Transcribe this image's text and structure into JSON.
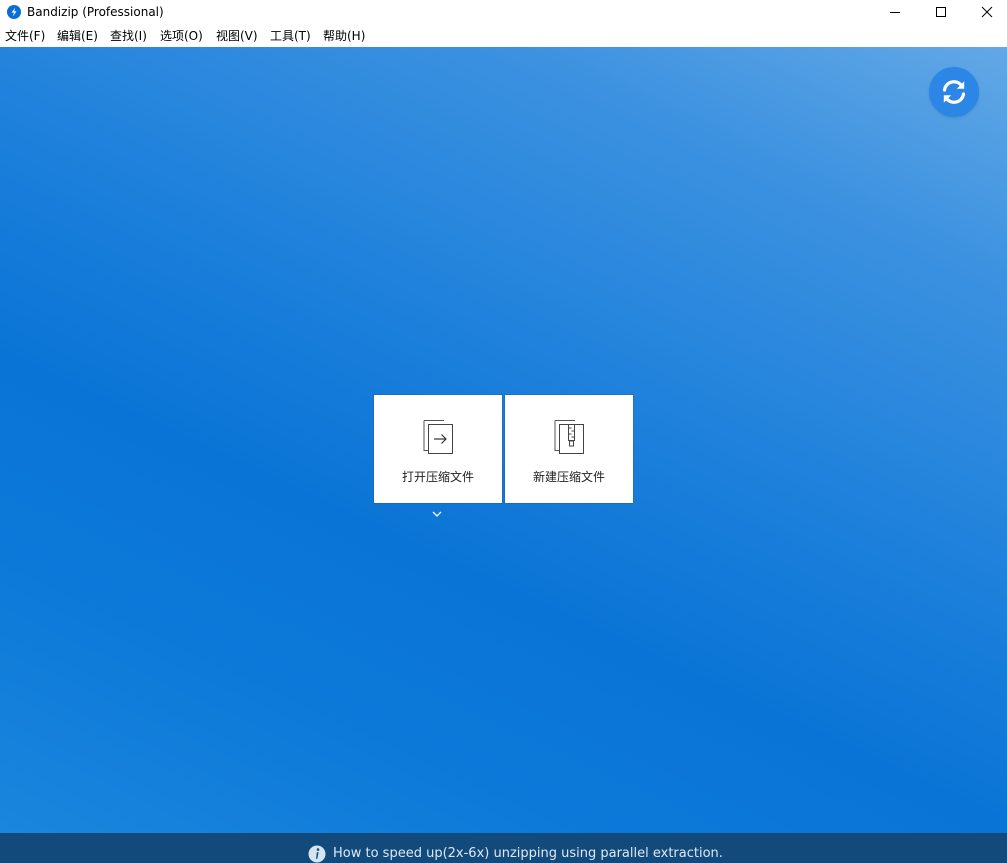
{
  "window": {
    "title": "Bandizip (Professional)",
    "controls": {
      "minimize": "minimize-icon",
      "maximize": "maximize-icon",
      "close": "close-icon"
    }
  },
  "menu": {
    "items": [
      "文件(F)",
      "编辑(E)",
      "查找(I)",
      "选项(O)",
      "视图(V)",
      "工具(T)",
      "帮助(H)"
    ]
  },
  "main": {
    "refresh_icon": "refresh-icon",
    "tiles": [
      {
        "label": "打开压缩文件",
        "icon": "open-archive-icon"
      },
      {
        "label": "新建压缩文件",
        "icon": "new-archive-icon"
      }
    ],
    "dropdown_icon": "chevron-down-icon"
  },
  "status": {
    "icon": "info-icon",
    "text": "How to speed up(2x-6x) unzipping using parallel extraction."
  },
  "colors": {
    "accent": "#2b86e6",
    "background_top_right": "#62a8e6",
    "background_main": "#0a74d6",
    "statusbar": "#134a7c"
  }
}
